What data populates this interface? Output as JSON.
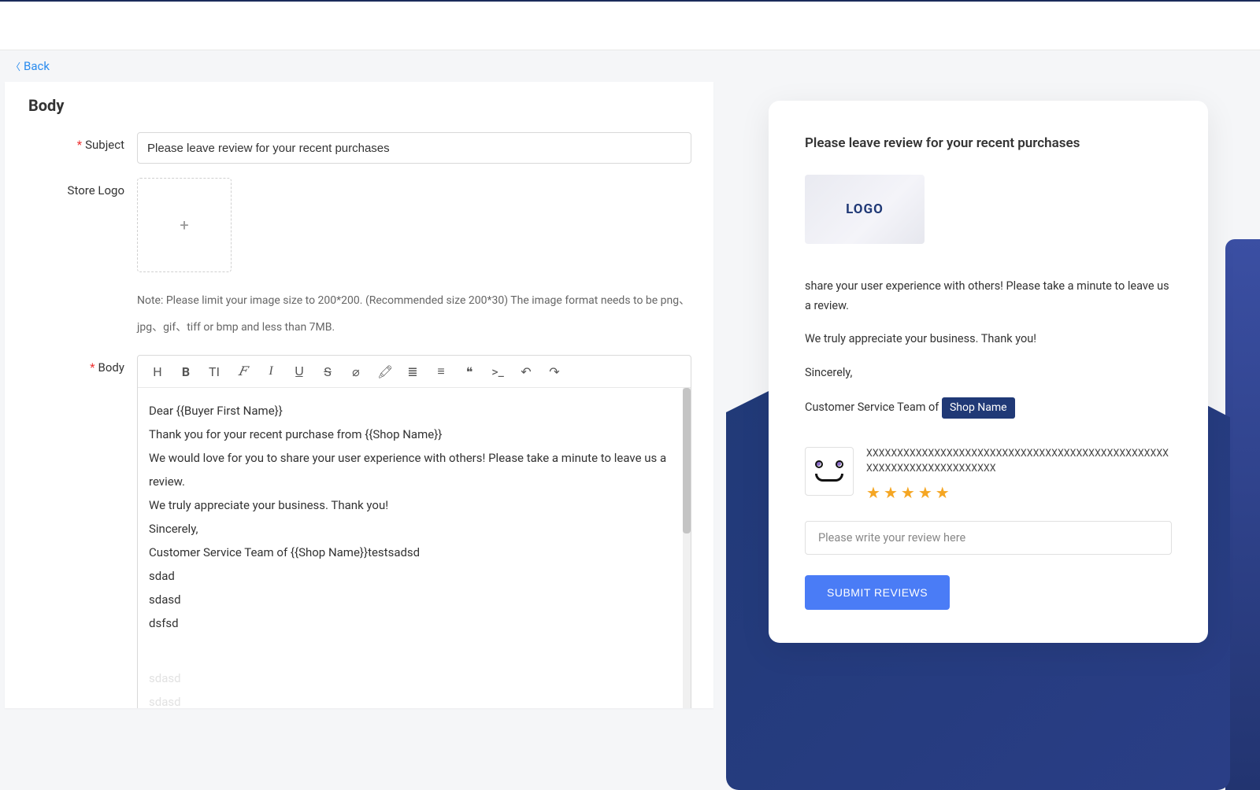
{
  "nav": {
    "back": "Back"
  },
  "section_title": "Body",
  "labels": {
    "subject": "Subject",
    "store_logo": "Store Logo",
    "body": "Body"
  },
  "subject_value": "Please leave review for your recent purchases",
  "logo_note": "Note: Please limit your image size to 200*200. (Recommended size 200*30) The image format needs to be png、jpg、gif、tiff or bmp and less than 7MB.",
  "body_lines": [
    "Dear {{Buyer First Name}}",
    "Thank you for your recent purchase from {{Shop Name}}",
    "We would love for you to share your user experience with others! Please take a minute to leave us a review.",
    "We truly appreciate your business. Thank you!",
    "Sincerely,",
    "Customer Service Team of {{Shop Name}}testsadsd",
    "sdad",
    "sdasd",
    "dsfsd"
  ],
  "ghost_lines": [
    "sdasd",
    "sdasd"
  ],
  "preview": {
    "title": "Please leave review for your recent purchases",
    "logo_text": "LOGO",
    "para1": "share your user experience with others! Please take a minute to leave us a review.",
    "para2": "We truly appreciate your business. Thank you!",
    "sincerely": "Sincerely,",
    "cs_team_prefix": "Customer Service Team of",
    "shop_tag": "Shop Name",
    "product_name": "XXXXXXXXXXXXXXXXXXXXXXXXXXXXXXXXXXXXXXXXXXXXXXXXXXXXXXXXXXXXXXXXXXXXXX",
    "review_placeholder": "Please write your review here",
    "submit": "SUBMIT REVIEWS",
    "rating": 5
  },
  "icons": {
    "heading": "H",
    "bold": "B",
    "textsize": "TI",
    "fontfamily": "𝐹",
    "italic": "I",
    "underline": "U̲",
    "strike": "S",
    "erase": "⌀",
    "color": "🖍",
    "list": "≣",
    "align": "≡",
    "quote": "❝",
    "code": ">_",
    "undo": "↶",
    "redo": "↷"
  }
}
